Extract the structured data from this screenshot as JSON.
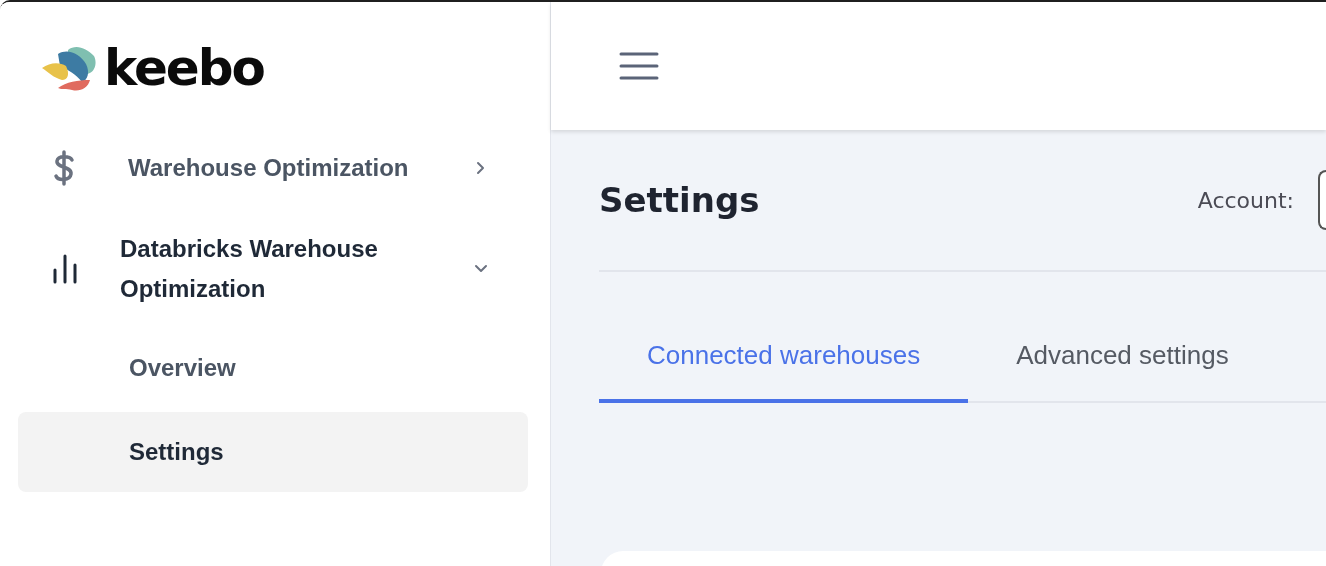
{
  "sidebar": {
    "logo": "keebo",
    "items": [
      {
        "label": "Warehouse Optimization",
        "expanded": false
      },
      {
        "label": "Databricks Warehouse Optimization",
        "expanded": true,
        "children": [
          {
            "label": "Overview",
            "selected": false
          },
          {
            "label": "Settings",
            "selected": true
          }
        ]
      }
    ]
  },
  "page": {
    "title": "Settings",
    "account_label": "Account:"
  },
  "tabs": [
    {
      "label": "Connected warehouses",
      "selected": true
    },
    {
      "label": "Advanced settings",
      "selected": false
    }
  ]
}
